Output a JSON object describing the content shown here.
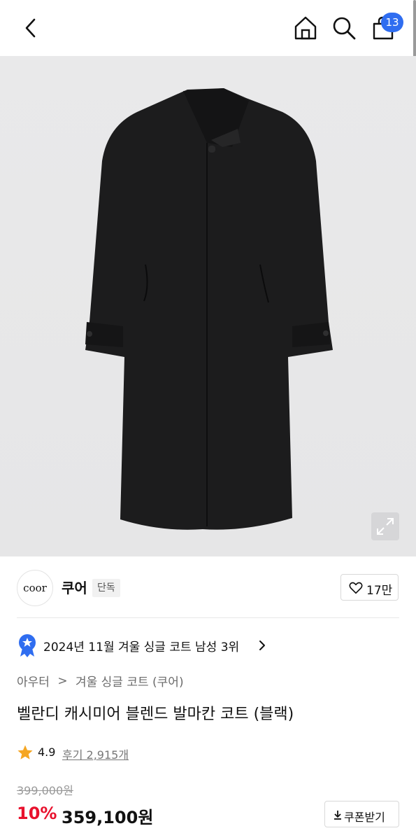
{
  "header": {
    "cart_badge": "13",
    "icons": [
      "chevron-left-icon",
      "home-icon",
      "search-icon",
      "shopping-bag-icon"
    ]
  },
  "gallery": {
    "expand_icon": "expand-icon"
  },
  "brand": {
    "logo_text": "coor",
    "name": "쿠어",
    "tag": "단독",
    "likes": "17만"
  },
  "ranking": {
    "text": "2024년 11월 겨울 싱글 코트 남성 3위"
  },
  "breadcrumb": {
    "items": [
      "아우터",
      "겨울 싱글 코트 (쿠어)"
    ],
    "separator": ">"
  },
  "product": {
    "title": "벨란디 캐시미어 블렌드 발마칸 코트 (블랙)",
    "rating": "4.9",
    "reviews": "후기 2,915개",
    "original_price": "399,000원",
    "discount": "10%",
    "sale_price": "359,100원",
    "coupon_label": "쿠폰받기"
  },
  "colors": {
    "badge": "#2f6df0",
    "discount": "#e8112d",
    "star": "#f5a623"
  }
}
